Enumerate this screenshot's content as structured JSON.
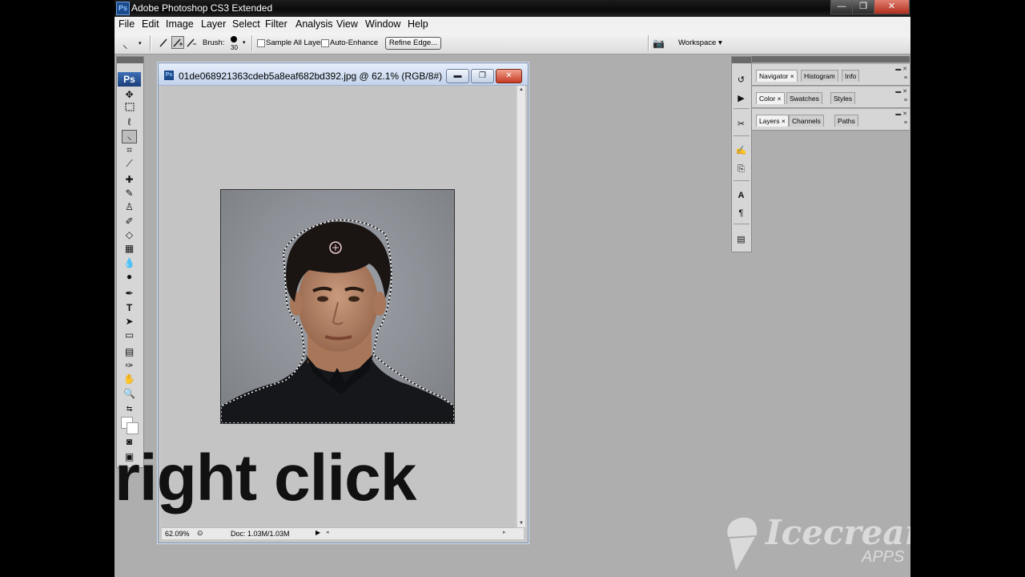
{
  "window": {
    "title": "Adobe Photoshop CS3 Extended",
    "app_icon": "Ps",
    "minimize_icon": "—",
    "maximize_icon": "❐",
    "close_icon": "✕"
  },
  "menu": [
    "File",
    "Edit",
    "Image",
    "Layer",
    "Select",
    "Filter",
    "Analysis",
    "View",
    "Window",
    "Help"
  ],
  "options": {
    "brush_label": "Brush:",
    "brush_size": "30",
    "sample_all_layers": "Sample All Layers",
    "auto_enhance": "Auto-Enhance",
    "refine_edge": "Refine Edge...",
    "workspace": "Workspace ▾"
  },
  "toolbox": {
    "logo": "Ps"
  },
  "document": {
    "title": "01de068921363cdeb5a8eaf682bd392.jpg @ 62.1% (RGB/8#)",
    "zoom": "62.09%",
    "doc_info": "Doc: 1.03M/1.03M"
  },
  "caption": "right click",
  "panels": {
    "group1": [
      "Navigator",
      "Histogram",
      "Info"
    ],
    "group2": [
      "Color",
      "Swatches",
      "Styles"
    ],
    "group3": [
      "Layers",
      "Channels",
      "Paths"
    ]
  },
  "watermark": {
    "brand": "Icecream",
    "sub": "APPS"
  }
}
